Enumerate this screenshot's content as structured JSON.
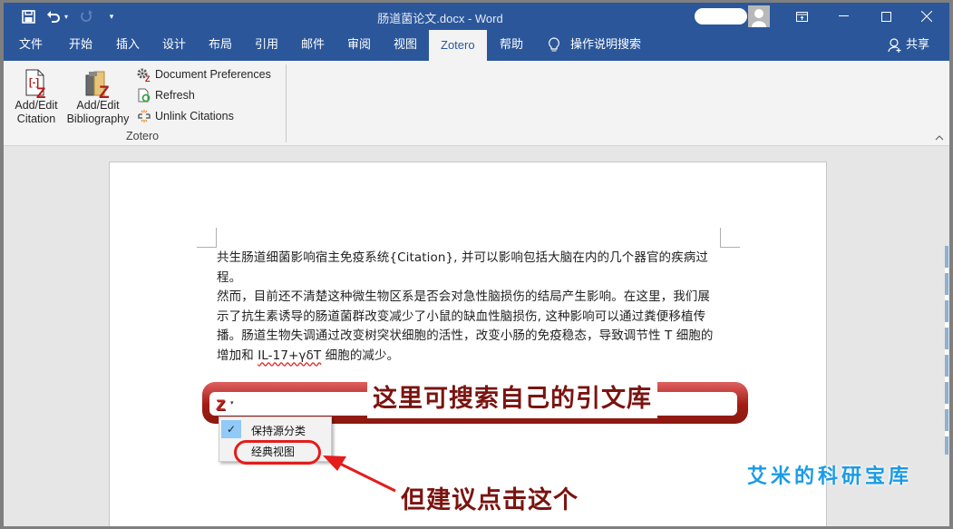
{
  "window": {
    "title": "肠道菌论文.docx  -  Word",
    "quick_access": {
      "save_icon": "💾",
      "undo_icon": "↶",
      "redo_icon": "↻",
      "customize_icon": "▾"
    },
    "controls": {
      "ribbon_display_icon": "⊡",
      "minimize_icon": "—",
      "maximize_icon": "☐",
      "close_icon": "✕"
    }
  },
  "ribbon_tabs": [
    {
      "label": "文件"
    },
    {
      "label": "开始"
    },
    {
      "label": "插入"
    },
    {
      "label": "设计"
    },
    {
      "label": "布局"
    },
    {
      "label": "引用"
    },
    {
      "label": "邮件"
    },
    {
      "label": "审阅"
    },
    {
      "label": "视图"
    },
    {
      "label": "Zotero",
      "active": true
    },
    {
      "label": "帮助"
    },
    {
      "label": "操作说明搜索"
    }
  ],
  "share_label": "共享",
  "zotero_group": {
    "label": "Zotero",
    "add_edit_citation": "Add/Edit\nCitation",
    "add_edit_citation_l1": "Add/Edit",
    "add_edit_citation_l2": "Citation",
    "add_edit_bibliography_l1": "Add/Edit",
    "add_edit_bibliography_l2": "Bibliography",
    "document_preferences": "Document Preferences",
    "refresh": "Refresh",
    "unlink_citations": "Unlink Citations"
  },
  "document": {
    "lines": [
      "共生肠道细菌影响宿主免疫系统{Citation}, 并可以影响包括大脑在内的几个器官的疾病过程。",
      "然而，目前还不清楚这种微生物区系是否会对急性脑损伤的结局产生影响。在这里，我们展",
      "示了抗生素诱导的肠道菌群改变减少了小鼠的缺血性脑损伤, 这种影响可以通过粪便移植传",
      "播。肠道生物失调通过改变树突状细胞的活性，改变小肠的免疫稳态，导致调节性 T 细胞的"
    ],
    "last_line_prefix": "增加和 ",
    "last_line_flagged": "IL-17+γδT",
    "last_line_suffix": " 细胞的减少。"
  },
  "zotero_search": {
    "logo": "Z",
    "caret": "▾",
    "annotation": "这里可搜索自己的引文库",
    "menu": [
      {
        "label": "保持源分类",
        "checked": true
      },
      {
        "label": "经典视图",
        "checked": false
      }
    ],
    "check_icon": "✓"
  },
  "annotations": {
    "arrow_caption": "但建议点击这个",
    "watermark": "艾米的科研宝库"
  },
  "colors": {
    "word_blue": "#2b579a",
    "annotation_red": "#7a1410",
    "highlight_red": "#e41c1c",
    "watermark_blue": "#1a9be6"
  }
}
